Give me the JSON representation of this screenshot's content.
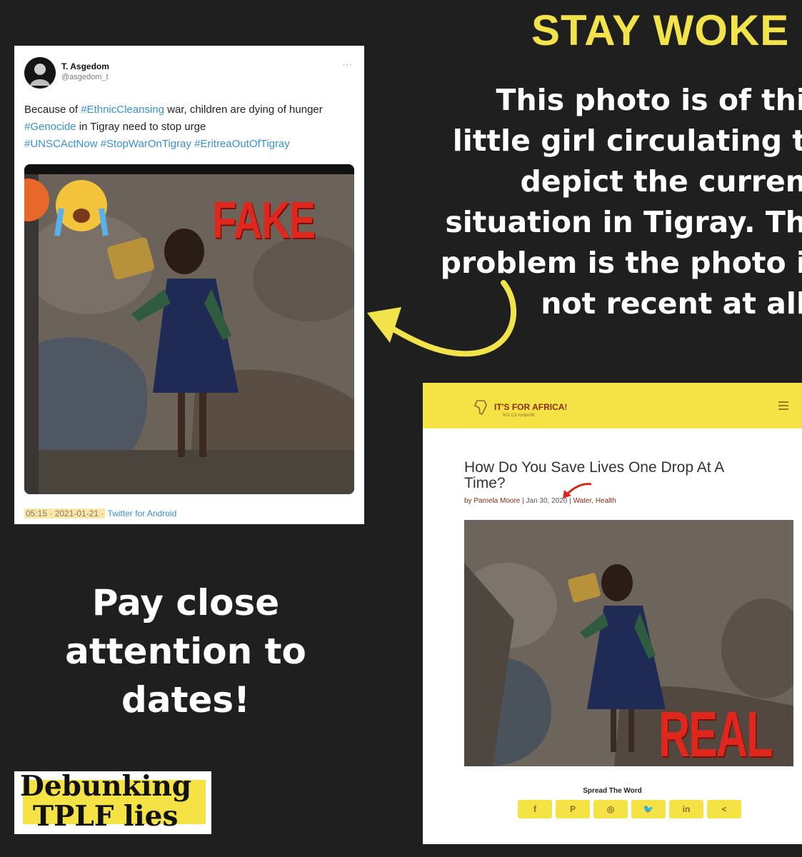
{
  "headline": "STAY WOKE",
  "right_caption": [
    "This photo is of thi",
    "little girl circulating t",
    "depict the curren",
    "situation in Tigray. Th",
    "problem is the photo i",
    "not recent at all"
  ],
  "left_caption": [
    "Pay close",
    "attention to",
    "dates!"
  ],
  "tweet": {
    "name": "T. Asgedom",
    "handle": "@asgedom_t",
    "more": "···",
    "line1_pre": "Because of ",
    "line1_tag": "#EthnicCleansing",
    "line1_post": " war, children are dying of hunger",
    "line2_tag": "#Genocide",
    "line2_post": " in Tigray need to stop urge",
    "line3_tags": "#UNSCActNow #StopWarOnTigray #EritreaOutOfTigray",
    "date": "05:15 · 2021-01-21 ·",
    "client": "Twitter for Android",
    "overlay_word": "FAKE"
  },
  "site": {
    "logo": "IT'S FOR AFRICA!",
    "logo_sub": "501 C3 nonprofit",
    "title": "How Do You Save Lives One Drop At A Time?",
    "meta_author": "by Pamela Moore",
    "meta_date": "Jan 30, 2020",
    "meta_cats": "Water, Health",
    "overlay_word": "REAL",
    "spread": "Spread The Word",
    "share_buttons": [
      {
        "icon": "facebook-icon",
        "label": "f"
      },
      {
        "icon": "pinterest-icon",
        "label": "P"
      },
      {
        "icon": "instagram-icon",
        "label": "◎"
      },
      {
        "icon": "twitter-icon",
        "label": "🐦"
      },
      {
        "icon": "linkedin-icon",
        "label": "in"
      },
      {
        "icon": "share-icon",
        "label": "<"
      }
    ]
  },
  "badge": [
    "Debunking",
    "TPLF lies"
  ],
  "colors": {
    "background": "#1f1f1f",
    "accent_yellow": "#f2e34a",
    "fake_red": "#e0271d",
    "link_blue": "#3a8fd0"
  }
}
